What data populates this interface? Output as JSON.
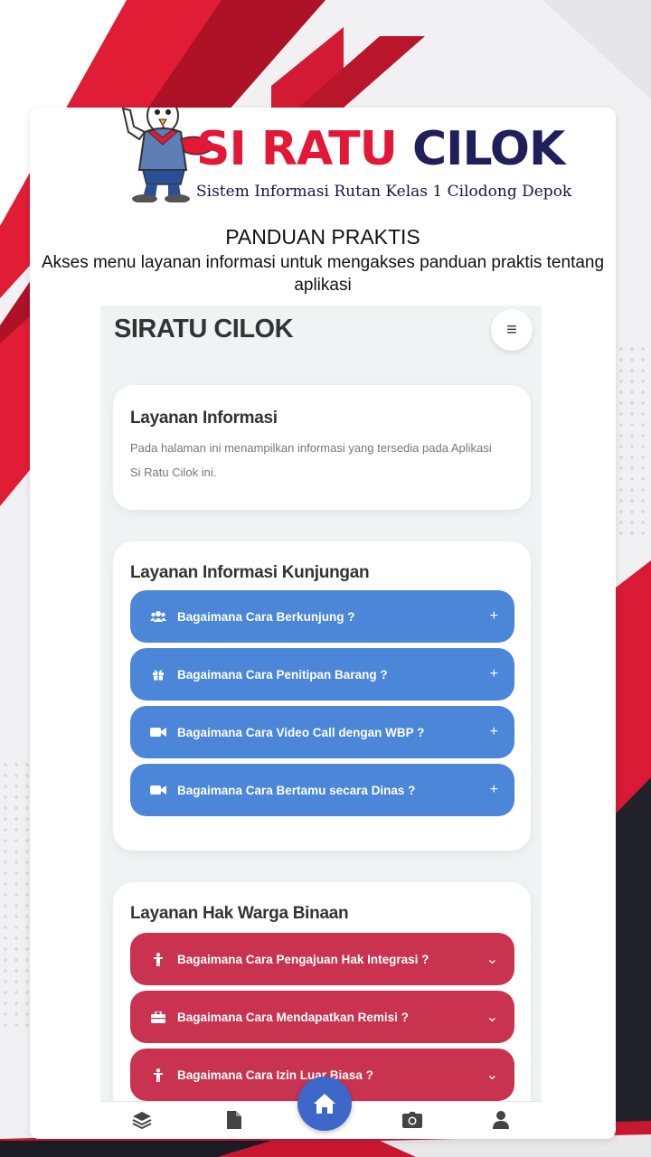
{
  "logo": {
    "title_red": "SI RATU",
    "title_blue": "CILOK",
    "subtitle": "Sistem Informasi Rutan Kelas 1 Cilodong Depok"
  },
  "heading": "PANDUAN PRAKTIS",
  "description": "Akses menu layanan informasi untuk mengakses panduan praktis tentang aplikasi",
  "app": {
    "title": "SIRATU CILOK",
    "menu_icon": "hamburger-icon",
    "info_card": {
      "title": "Layanan Informasi",
      "text": "Pada halaman ini menampilkan informasi yang tersedia pada Aplikasi Si Ratu Cilok ini."
    },
    "kunjungan": {
      "title": "Layanan Informasi Kunjungan",
      "items": [
        {
          "label": "Bagaimana Cara Berkunjung ?",
          "icon": "users-icon",
          "toggle": "+"
        },
        {
          "label": "Bagaimana Cara Penitipan Barang ?",
          "icon": "gift-icon",
          "toggle": "+"
        },
        {
          "label": "Bagaimana Cara Video Call dengan WBP ?",
          "icon": "video-icon",
          "toggle": "+"
        },
        {
          "label": "Bagaimana Cara Bertamu secara Dinas ?",
          "icon": "video-icon",
          "toggle": "+"
        }
      ]
    },
    "hak": {
      "title": "Layanan Hak Warga Binaan",
      "items": [
        {
          "label": "Bagaimana Cara Pengajuan Hak Integrasi ?",
          "icon": "person-icon",
          "toggle": "⌄"
        },
        {
          "label": "Bagaimana Cara Mendapatkan Remisi ?",
          "icon": "briefcase-icon",
          "toggle": "⌄"
        },
        {
          "label": "Bagaimana Cara Izin Luar Biasa ?",
          "icon": "person-icon",
          "toggle": "⌄"
        }
      ]
    },
    "bottom_nav": [
      "layers-icon",
      "document-icon",
      "home-icon",
      "camera-icon",
      "user-icon"
    ]
  },
  "colors": {
    "brand_red": "#e31837",
    "brand_navy": "#1f1f5c",
    "accordion_blue": "#4b86d8",
    "accordion_red": "#c9334f",
    "home_button": "#3d68c9"
  }
}
